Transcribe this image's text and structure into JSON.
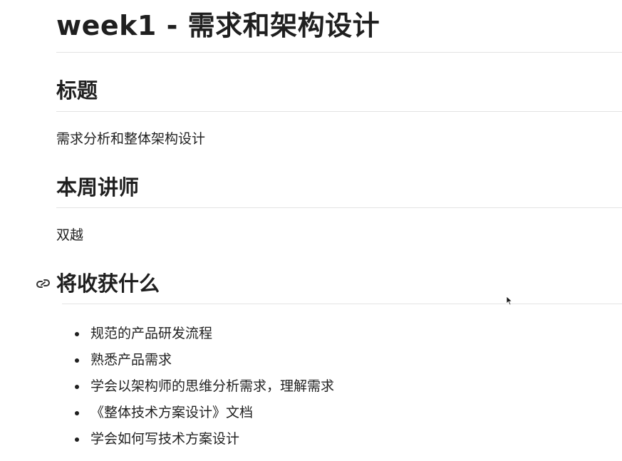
{
  "doc": {
    "title": "week1 - 需求和架构设计",
    "sections": [
      {
        "heading": "标题",
        "body": "需求分析和整体架构设计"
      },
      {
        "heading": "本周讲师",
        "body": "双越"
      },
      {
        "heading": "将收获什么",
        "items": [
          "规范的产品研发流程",
          "熟悉产品需求",
          "学会以架构师的思维分析需求，理解需求",
          "《整体技术方案设计》文档",
          "学会如何写技术方案设计"
        ]
      }
    ]
  },
  "icons": {
    "anchor": "link-icon",
    "pointer": "mouse-cursor-icon"
  },
  "colors": {
    "text": "#1f1f1f",
    "rule": "#e3e3e3",
    "background": "#ffffff"
  }
}
